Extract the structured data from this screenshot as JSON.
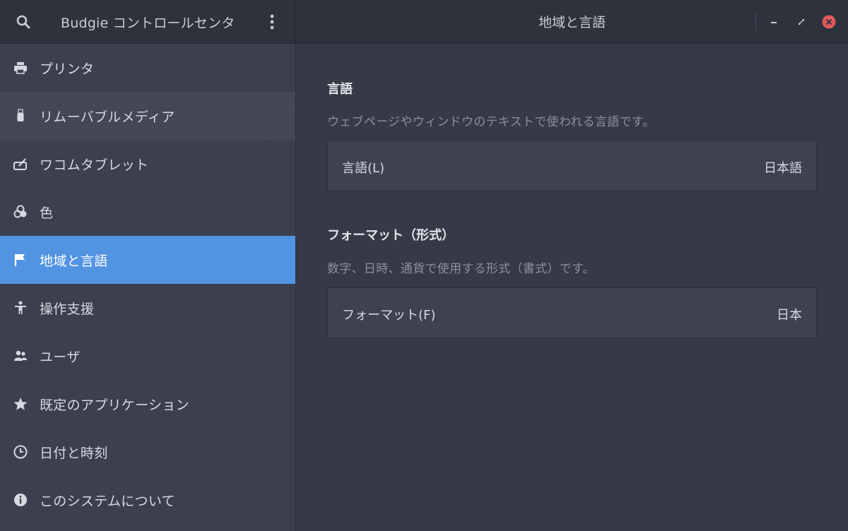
{
  "header": {
    "app_title": "Budgie コントロールセンタ",
    "page_title": "地域と言語",
    "search_icon": "search-icon",
    "menu_icon": "more-vertical-icon"
  },
  "window_controls": {
    "minimize": "minimize-icon",
    "maximize": "restore-icon",
    "close": "close-icon",
    "close_color": "#e05a5a"
  },
  "sidebar": {
    "items": [
      {
        "label": "プリンタ",
        "icon": "printer-icon"
      },
      {
        "label": "リムーバブルメディア",
        "icon": "usb-drive-icon"
      },
      {
        "label": "ワコムタブレット",
        "icon": "tablet-pen-icon"
      },
      {
        "label": "色",
        "icon": "color-circles-icon"
      },
      {
        "label": "地域と言語",
        "icon": "flag-icon"
      },
      {
        "label": "操作支援",
        "icon": "accessibility-person-icon"
      },
      {
        "label": "ユーザ",
        "icon": "users-icon"
      },
      {
        "label": "既定のアプリケーション",
        "icon": "star-icon"
      },
      {
        "label": "日付と時刻",
        "icon": "clock-icon"
      },
      {
        "label": "このシステムについて",
        "icon": "info-icon"
      }
    ],
    "selected_index": 4,
    "accent_color": "#5294e2"
  },
  "content": {
    "language": {
      "title": "言語",
      "description": "ウェブページやウィンドウのテキストで使われる言語です。",
      "row_label": "言語(L)",
      "row_value": "日本語"
    },
    "formats": {
      "title": "フォーマット（形式）",
      "description": "数字、日時、通貨で使用する形式（書式）です。",
      "row_label": "フォーマット(F)",
      "row_value": "日本"
    }
  }
}
